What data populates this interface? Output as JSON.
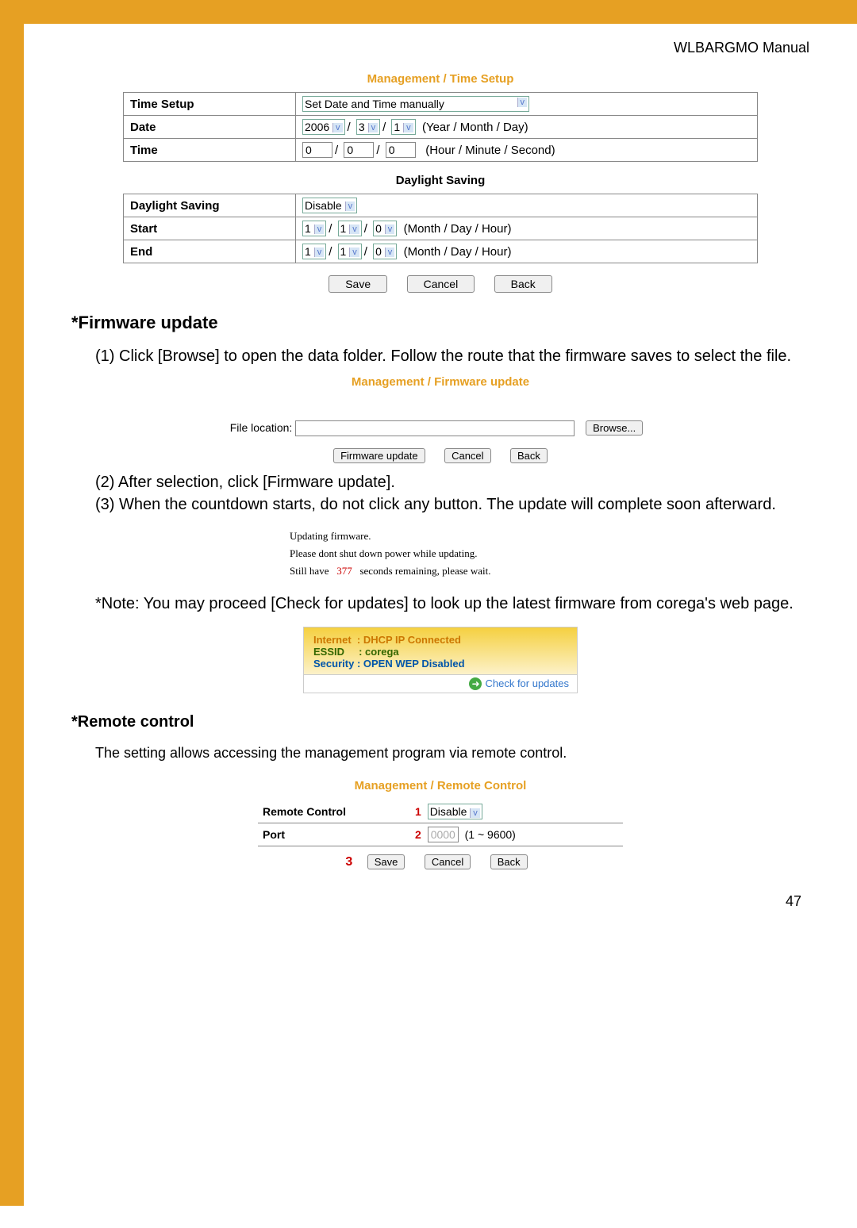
{
  "header": "WLBARGMO Manual",
  "time_setup": {
    "breadcrumb": "Management / Time Setup",
    "rows": {
      "time_setup_label": "Time Setup",
      "time_setup_value": "Set Date and Time manually",
      "date_label": "Date",
      "year": "2006",
      "month": "3",
      "day": "1",
      "date_hint": "(Year / Month / Day)",
      "time_label": "Time",
      "hour": "0",
      "minute": "0",
      "second": "0",
      "time_hint": "(Hour / Minute / Second)"
    },
    "ds": {
      "title": "Daylight Saving",
      "ds_label": "Daylight Saving",
      "ds_value": "Disable",
      "start_label": "Start",
      "s_m": "1",
      "s_d": "1",
      "s_h": "0",
      "end_label": "End",
      "e_m": "1",
      "e_d": "1",
      "e_h": "0",
      "hint": "(Month / Day / Hour)"
    },
    "buttons": {
      "save": "Save",
      "cancel": "Cancel",
      "back": "Back"
    }
  },
  "firmware": {
    "heading": "*Firmware update",
    "step1": "(1) Click [Browse] to open the data folder.  Follow the route that the firmware saves to select the file.",
    "breadcrumb": "Management / Firmware update",
    "file_label": "File location:",
    "browse": "Browse...",
    "fw_update": "Firmware update",
    "cancel": "Cancel",
    "back": "Back",
    "step2": "(2) After selection, click [Firmware update].",
    "step3": "(3) When the countdown starts, do not click any button.  The update will complete soon afterward.",
    "updating": {
      "l1": "Updating firmware.",
      "l2": "Please dont shut down power while updating.",
      "l3a": "Still have",
      "secs": "377",
      "l3b": "seconds remaining, please wait."
    },
    "note": "*Note: You may proceed [Check for updates] to look up the latest firmware from corega's web page."
  },
  "status": {
    "internet_label": "Internet",
    "internet_value": ": DHCP IP Connected",
    "essid_label": "ESSID",
    "essid_value": ": corega",
    "security_label": "Security",
    "security_value": ": OPEN  WEP Disabled",
    "check": "Check for updates"
  },
  "remote": {
    "heading": "*Remote control",
    "desc": "The setting allows accessing the management program via remote control.",
    "breadcrumb": "Management / Remote Control",
    "rc_label": "Remote Control",
    "rc_value": "Disable",
    "port_label": "Port",
    "port_value": "0000",
    "port_hint": "(1 ~ 9600)",
    "save": "Save",
    "cancel": "Cancel",
    "back": "Back"
  },
  "page_num": "47"
}
